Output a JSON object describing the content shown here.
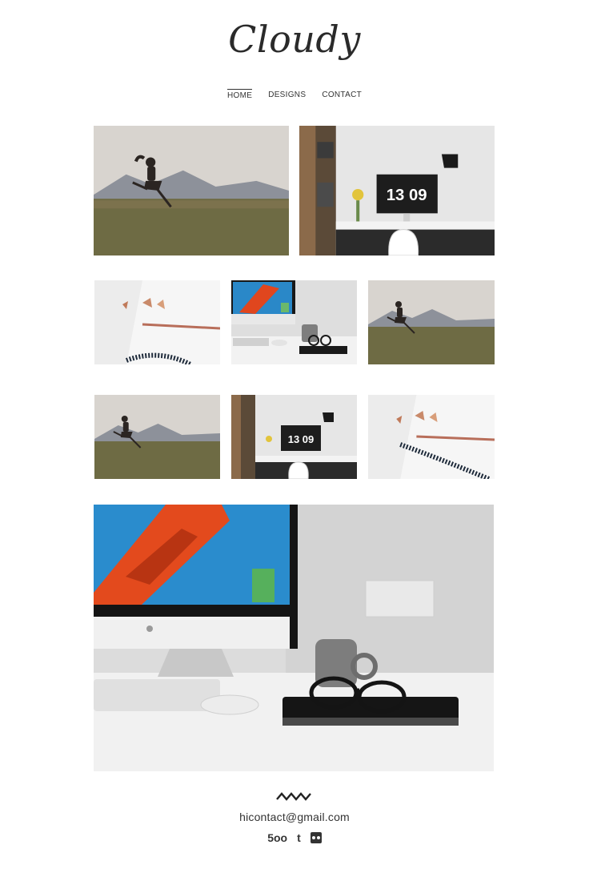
{
  "site": {
    "logo": "Cloudy"
  },
  "nav": {
    "items": [
      "HOME",
      "DESIGNS",
      "CONTACT"
    ],
    "active": "HOME"
  },
  "gallery": {
    "clock_text": "13 09",
    "photos": [
      {
        "subject": "jumping-woman-field"
      },
      {
        "subject": "desk-clock"
      },
      {
        "subject": "pencil-notebook"
      },
      {
        "subject": "imac-desk"
      },
      {
        "subject": "jumping-woman-field"
      },
      {
        "subject": "jumping-woman-field"
      },
      {
        "subject": "desk-clock"
      },
      {
        "subject": "pencil-notebook"
      },
      {
        "subject": "imac-desk"
      }
    ]
  },
  "footer": {
    "email": "hicontact@gmail.com",
    "social": [
      "500px-icon",
      "tumblr-icon",
      "flickr-icon"
    ],
    "social_labels": {
      "px": "5oo",
      "tumblr": "t"
    }
  }
}
